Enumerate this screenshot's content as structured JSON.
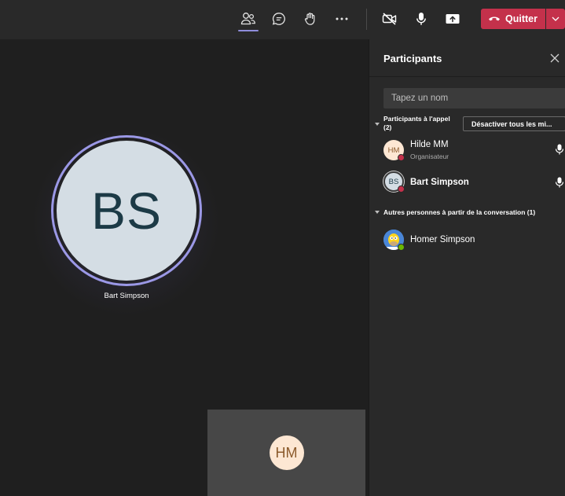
{
  "toolbar": {
    "icons": [
      "people-icon",
      "chat-icon",
      "raise-hand-icon",
      "more-options-icon",
      "camera-off-icon",
      "microphone-icon",
      "share-screen-icon",
      "phone-hangup-icon"
    ],
    "leave_label": "Quitter",
    "accent": "#c4314b",
    "active_indicator": "#8f8ddb"
  },
  "stage": {
    "main_initials": "BS",
    "main_name": "Bart Simpson",
    "pip_initials": "HM"
  },
  "panel": {
    "title": "Participants",
    "search_placeholder": "Tapez un nom",
    "in_call_section": "Participants à l'appel",
    "in_call_count": "(2)",
    "mute_all_label": "Désactiver tous les mi...",
    "participants": [
      {
        "initials": "HM",
        "name": "Hilde MM",
        "role": "Organisateur",
        "status": "busy"
      },
      {
        "initials": "BS",
        "name": "Bart Simpson",
        "role": "",
        "status": "busy"
      }
    ],
    "others_section": "Autres personnes à partir de la conversation (1)",
    "others": [
      {
        "name": "Homer Simpson",
        "status": "online"
      }
    ]
  }
}
